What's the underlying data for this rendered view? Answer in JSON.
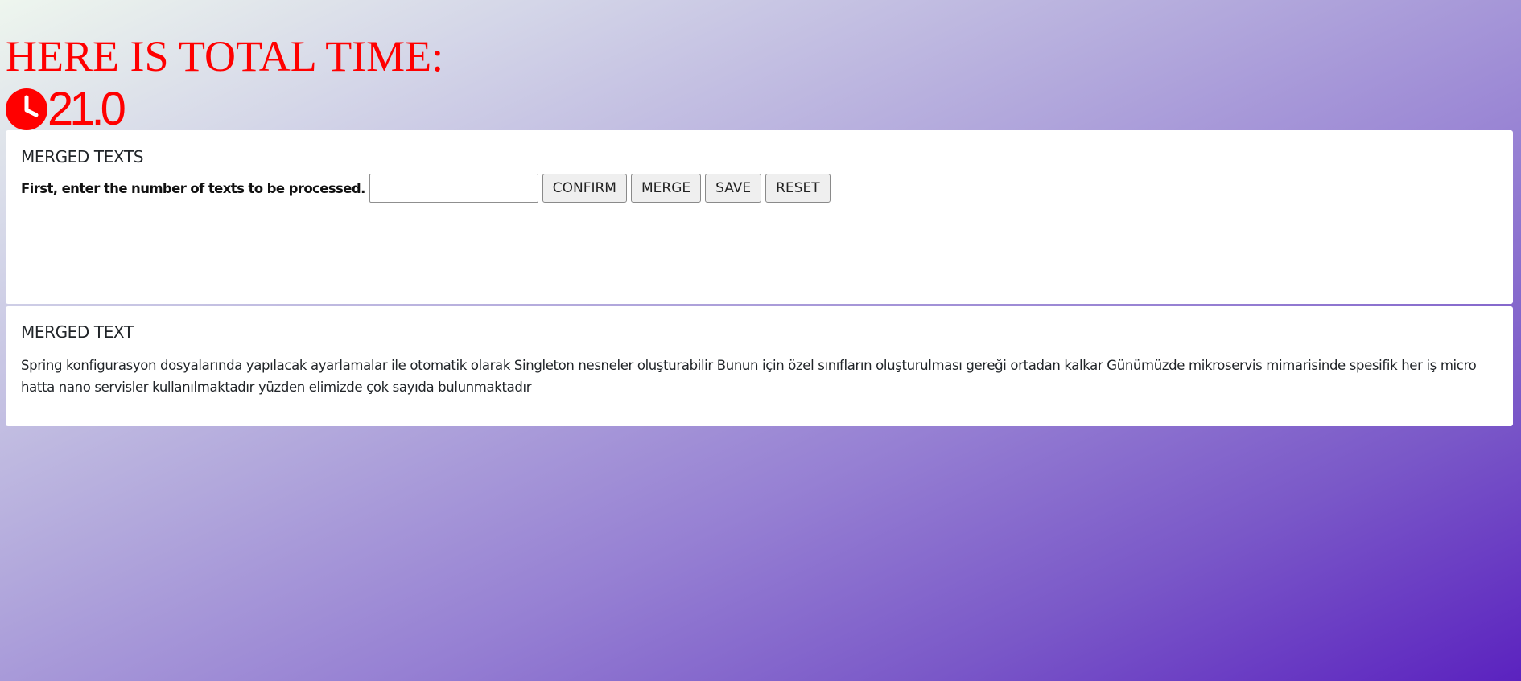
{
  "timer": {
    "title": "HERE IS TOTAL TIME:",
    "value": "21.0",
    "icon": "clock-icon",
    "color": "#ff0000"
  },
  "merged_texts_card": {
    "title": "MERGED TEXTS",
    "prompt_label": "First, enter the number of texts to be processed.",
    "input_value": "",
    "buttons": {
      "confirm": "CONFIRM",
      "merge": "MERGE",
      "save": "SAVE",
      "reset": "RESET"
    }
  },
  "merged_text_card": {
    "title": "MERGED TEXT",
    "body": "Spring konfigurasyon dosyalarında yapılacak ayarlamalar ile otomatik olarak Singleton nesneler oluşturabilir Bunun için özel sınıfların oluşturulması gereği ortadan kalkar Günümüzde mikroservis mimarisinde spesifik her iş micro hatta nano servisler kullanılmaktadır yüzden elimizde çok sayıda bulunmaktadır"
  }
}
